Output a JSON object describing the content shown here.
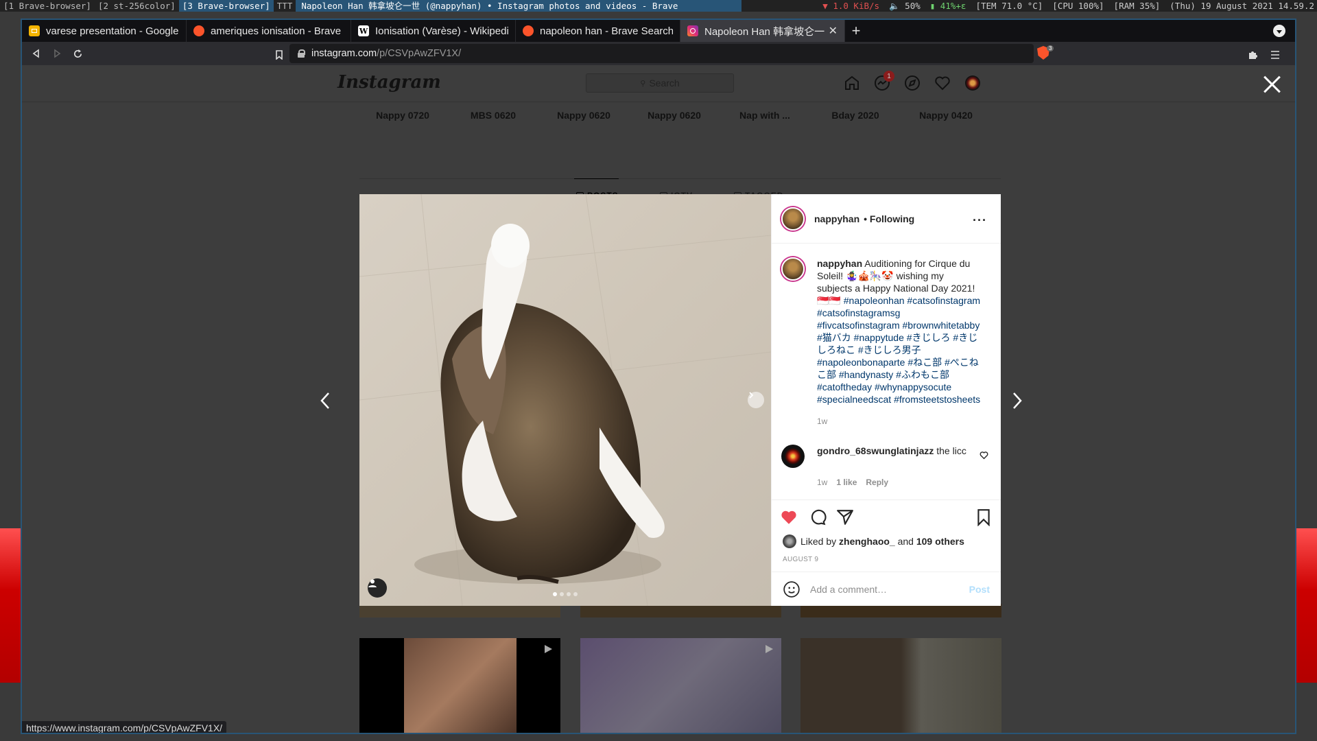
{
  "wm": {
    "workspaces": [
      "[1 Brave-browser]",
      "[2 st-256color]",
      "[3 Brave-browser]",
      "TTT"
    ],
    "window_title": "Napoleon Han 韩拿坡仑一世 (@nappyhan) • Instagram photos and videos - Brave",
    "status": {
      "net": "▼ 1.0 KiB/s",
      "vol": "🔈 50%",
      "bat": "▮ 41%+ε",
      "temp": "[TEM 71.0 °C]",
      "cpu": "[CPU 100%]",
      "ram": "[RAM 35%]",
      "datetime": "(Thu) 19 August 2021 14.59.2"
    }
  },
  "browser": {
    "tabs": [
      {
        "label": "varese presentation - Google S",
        "icon": "google-slides-icon",
        "color": "#f4b400"
      },
      {
        "label": "ameriques ionisation - Brave S",
        "icon": "brave-search-icon",
        "color": "#fb542b"
      },
      {
        "label": "Ionisation (Varèse) - Wikipedia",
        "icon": "wikipedia-icon",
        "color": "#ffffff"
      },
      {
        "label": "napoleon han - Brave Search",
        "icon": "brave-search-icon",
        "color": "#fb542b"
      },
      {
        "label": "Napoleon Han 韩拿坡仑一世",
        "icon": "instagram-icon",
        "color": "#e1306c"
      }
    ],
    "url_host": "instagram.com",
    "url_path": "/p/CSVpAwZFV1X/",
    "shields_count": "3",
    "status_url": "https://www.instagram.com/p/CSVpAwZFV1X/"
  },
  "ig": {
    "logo": "Instagram",
    "search_placeholder": "Search",
    "notif_count": "1",
    "highlights": [
      "Nappy 0720",
      "MBS 0620",
      "Nappy 0620",
      "Nappy 0620",
      "Nap with ...",
      "Bday 2020",
      "Nappy 0420"
    ],
    "profile_tabs": [
      "POSTS",
      "IGTV",
      "TAGGED"
    ]
  },
  "post": {
    "username": "nappyhan",
    "following": "• Following",
    "more": "···",
    "caption_user": "nappyhan",
    "caption_text": " Auditioning for Cirque du Soleil! 🤹‍♀️🎪🎠🤡 wishing my subjects a Happy National Day 2021!🇸🇬🇸🇬",
    "caption_tags": "#napoleonhan #catsofinstagram #catsofinstagramsg #fivcatsofinstagram #brownwhitetabby #猫バカ #nappytude #きじしろ #きじしろねこ #きじしろ男子 #napoleonbonaparte #ねこ部 #ぺこねこ部 #handynasty #ふわもこ部 #catoftheday #whynappysocute #specialneedscat #fromsteetstosheets",
    "caption_time": "1w",
    "comment_user": "gondro_68swunglatinjazz",
    "comment_text": " the licc",
    "comment_time": "1w",
    "comment_likes": "1 like",
    "comment_reply": "Reply",
    "liked_by_prefix": "Liked by ",
    "liked_by_user": "zhenghaoo_",
    "liked_by_and": " and ",
    "liked_by_others": "109 others",
    "date": "AUGUST 9",
    "comment_placeholder": "Add a comment…",
    "post_button": "Post",
    "carousel_dots": 4,
    "carousel_active": 1,
    "colors": {
      "like": "#ed4956",
      "link": "#00376b",
      "post_btn": "#b2dffc"
    }
  }
}
